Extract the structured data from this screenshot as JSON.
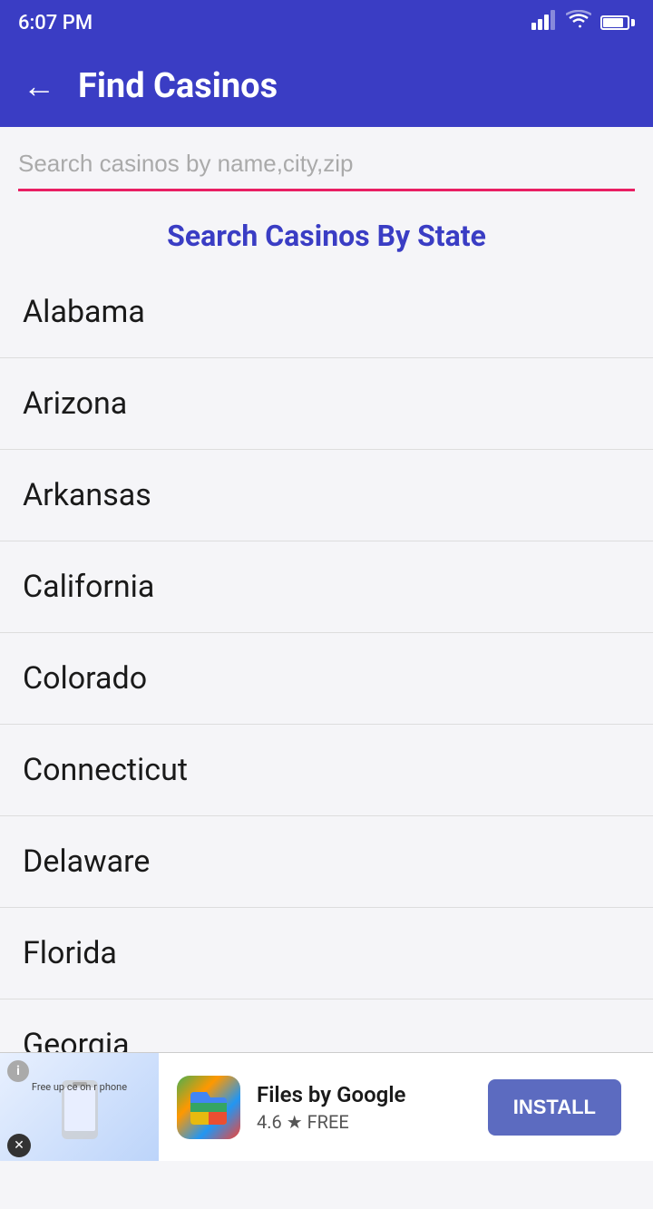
{
  "statusBar": {
    "time": "6:07 PM"
  },
  "appBar": {
    "title": "Find Casinos",
    "backLabel": "←"
  },
  "search": {
    "placeholder": "Search casinos by name,city,zip",
    "value": ""
  },
  "stateList": {
    "heading": "Search Casinos By State",
    "states": [
      {
        "name": "Alabama"
      },
      {
        "name": "Arizona"
      },
      {
        "name": "Arkansas"
      },
      {
        "name": "California"
      },
      {
        "name": "Colorado"
      },
      {
        "name": "Connecticut"
      },
      {
        "name": "Delaware"
      },
      {
        "name": "Florida"
      },
      {
        "name": "Georgia"
      }
    ]
  },
  "ad": {
    "appName": "Files by Google",
    "rating": "4.6 ★ FREE",
    "installLabel": "INSTALL",
    "closeLabel": "✕",
    "infoLabel": "i",
    "adTextLines": "Free up\nce on\nr phone"
  }
}
